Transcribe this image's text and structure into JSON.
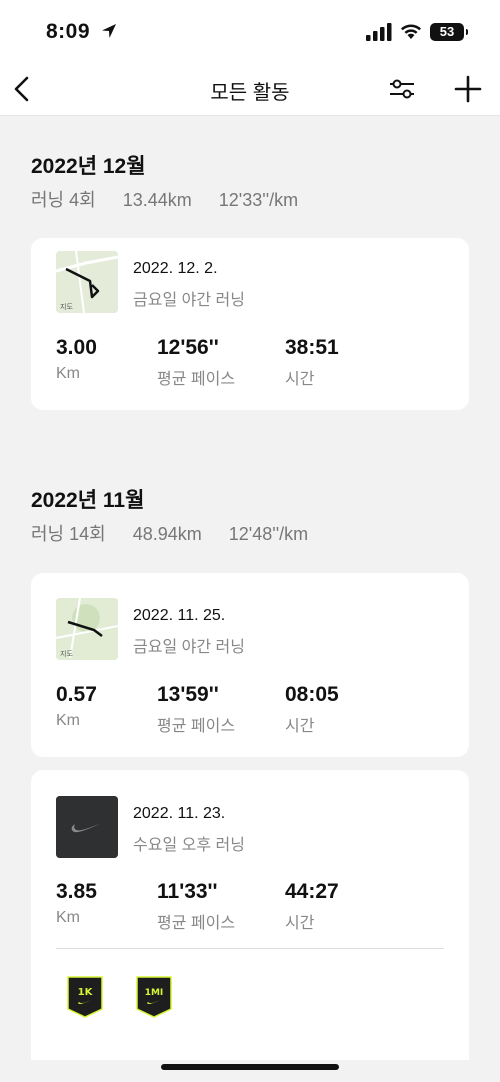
{
  "status": {
    "time": "8:09",
    "battery": "53"
  },
  "nav": {
    "title": "모든 활동"
  },
  "months": [
    {
      "title": "2022년 12월",
      "runs": "러닝 4회",
      "distance": "13.44km",
      "pace": "12'33''/km"
    },
    {
      "title": "2022년 11월",
      "runs": "러닝 14회",
      "distance": "48.94km",
      "pace": "12'48''/km"
    }
  ],
  "activities": [
    {
      "date": "2022. 12. 2.",
      "name": "금요일 야간 러닝",
      "distance": "3.00",
      "distance_unit": "Km",
      "pace": "12'56''",
      "pace_label": "평균 페이스",
      "time": "38:51",
      "time_label": "시간",
      "map_label": "지도"
    },
    {
      "date": "2022. 11. 25.",
      "name": "금요일 야간 러닝",
      "distance": "0.57",
      "distance_unit": "Km",
      "pace": "13'59''",
      "pace_label": "평균 페이스",
      "time": "08:05",
      "time_label": "시간",
      "map_label": "지도"
    },
    {
      "date": "2022. 11. 23.",
      "name": "수요일 오후 러닝",
      "distance": "3.85",
      "distance_unit": "Km",
      "pace": "11'33''",
      "pace_label": "평균 페이스",
      "time": "44:27",
      "time_label": "시간",
      "badges": [
        "1K",
        "1MI"
      ]
    }
  ],
  "colors": {
    "badge_bg": "#1e1e1e",
    "badge_accent": "#d4f536",
    "map_bg": "#dfead0"
  }
}
